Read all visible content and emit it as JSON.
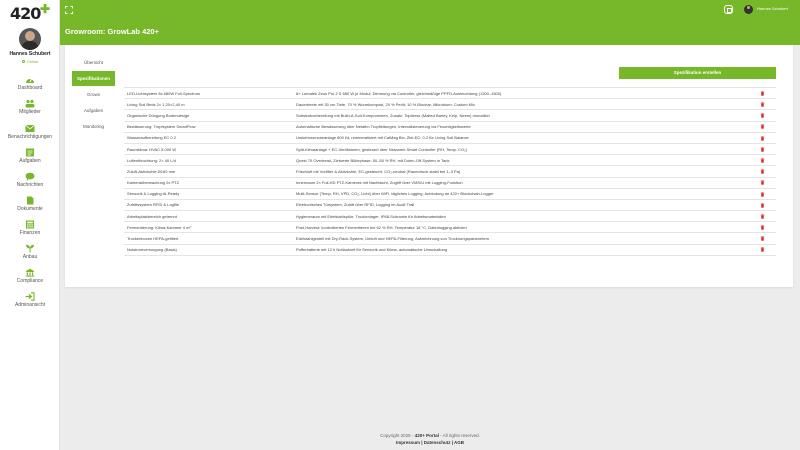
{
  "sidebar": {
    "logo": "420",
    "user": {
      "name": "Hannes Schubert",
      "status": "Online"
    },
    "items": [
      {
        "label": "Dashboard",
        "icon": "dashboard-icon"
      },
      {
        "label": "Mitglieder",
        "icon": "users-icon"
      },
      {
        "label": "Benachrichtigungen",
        "icon": "envelope-icon"
      },
      {
        "label": "Aufgaben",
        "icon": "tasks-icon"
      },
      {
        "label": "Nachrichten",
        "icon": "chat-icon"
      },
      {
        "label": "Dokumente",
        "icon": "document-icon"
      },
      {
        "label": "Finanzen",
        "icon": "finance-icon"
      },
      {
        "label": "Anbau",
        "icon": "plant-icon"
      },
      {
        "label": "Compliance",
        "icon": "compliance-icon"
      },
      {
        "label": "Adminansicht",
        "icon": "admin-icon"
      }
    ]
  },
  "header": {
    "user": "Hannes Schubert",
    "title": "Growroom: GrowLab 420+"
  },
  "tabs": [
    {
      "label": "Übersicht"
    },
    {
      "label": "Spezifikationen"
    },
    {
      "label": "Grows"
    },
    {
      "label": "Aufgaben"
    },
    {
      "label": "Monitoring"
    }
  ],
  "spec_button_label": "Spezifikation erstellen",
  "specs": [
    {
      "name": "LED-Lichtsystem 8x 680W Full-Spectrum",
      "desc": "8× Lumatek Zeus Pro 2 S 680 W je Modul; Dimmung via Controller, gleichmäßige PPFD-Ausleuchtung (1200–1500)"
    },
    {
      "name": "Living Soil Beds 2× 1,20×2,40 m",
      "desc": "Dauerbeete mit 30 cm Tiefe, 70 % Wurmkompost, 20 % Perlit, 10 % Biochar; Mikrobiom: Custom Mix"
    },
    {
      "name": "Organische Düngung Bodendesign",
      "desc": "Substratvorbereitung mit Build-A-Soil-Komponenten, Zusatz: Topdress (Malted Barley, Kelp, Neem) monatlich"
    },
    {
      "name": "Bewässerung: Tropfsystem SmartFlow",
      "desc": "Automatische Bewässerung über Netafim Tropfleitungen, Intervallsteuerung via Feuchtigkeitswerte"
    },
    {
      "name": "Wasseraufbereitung EC 0.2",
      "desc": "Umkehrosmoseanlage 800 l/d, remineralisiert mit CalMag Bio, Ziel-EC: 0.2 für Living Soil Balance"
    },
    {
      "name": "Raumklima: HVAC 5.000 W",
      "desc": "Split-Klimaanlage + EC-Ventilatoren, gesteuert über Netzwerk Smart Controller (RH, Temp, CO₂)"
    },
    {
      "name": "Luftentfeuchtung: 2× 40 L/d",
      "desc": "Quest 70 Overhead, Zielwerte Blütephase: 50–55 % RH, mit Dolen-Off-System in Tank"
    },
    {
      "name": "Zuluft-Aktivkohle Ø160 mm",
      "desc": "Frischluft mit Vorfilter & Aktivkohle, EC-gesteuert, CO₂-neutral (Raumdruck stabil bei 1–3 Pa)"
    },
    {
      "name": "Kameraüberwachung 2x PTZ",
      "desc": "Innenraum 2× Full-HD PTZ-Kameras mit Nachtsicht, Zugriff über VMS/U mit Logging-Funktion"
    },
    {
      "name": "Sensorik & Logging AI-Ready",
      "desc": "Multi-Sensor (Temp, RH, VPD, CO₂, Licht) über WiFi, tägliches Logging, Anbindung an 420+ Blockchain-Logger"
    },
    {
      "name": "Zutrittssystem RFID & Logfile",
      "desc": "Elektronisches Türsystem, Zutritt über RFID, Logging im Audit Trail"
    },
    {
      "name": "Arbeitsplatzbereich getrennt",
      "desc": "Hygieneraum mit Edelstahlspüle, Trockenlager, IP68-Schranke für Arbeitsmaterialien"
    },
    {
      "name": "Fermentierung: Klima-Kammer 4 m²",
      "desc": "Post-Harvest: kontrolliertes Fermentieren bei 62 % RH, Temperatur 18 °C, Datenlogging aktiviert"
    },
    {
      "name": "Trockenboxen HEPA-gefiltert",
      "desc": "Edelstahlgestell mit Dry-Rack-System, Umluft und HEPA-Filterung, Aufzeichnung von Trocknungsparametern"
    },
    {
      "name": "Notstromversorgung (Basis)",
      "desc": "Pufferbatterie mit 12 h Notlaufzeit für Sensorik und Klima, automatische Umschaltung"
    }
  ],
  "footer": {
    "copyright_prefix": "Copyright 2025 -",
    "brand": "420+ Portal",
    "copyright_suffix": "- All rights reserved.",
    "links": "Impressum | Datenschutz | AGB"
  },
  "colors": {
    "accent": "#76b82a",
    "danger": "#d9262c",
    "background": "#ececec"
  }
}
